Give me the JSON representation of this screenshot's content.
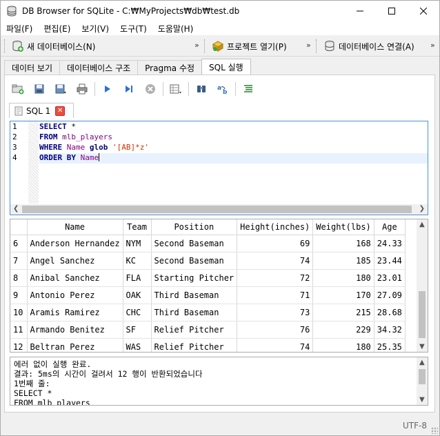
{
  "window": {
    "title": "DB Browser for SQLite - C:₩MyProjects₩db₩test.db"
  },
  "menu": [
    "파일(F)",
    "편집(E)",
    "보기(V)",
    "도구(T)",
    "도움말(H)"
  ],
  "toolbar": {
    "new_db": "새 데이터베이스(N)",
    "open_project": "프로젝트 열기(P)",
    "connect_db": "데이터베이스 연결(A)",
    "more": "»"
  },
  "tabs": [
    "데이터 보기",
    "데이터베이스 구조",
    "Pragma 수정",
    "SQL 실행"
  ],
  "sql_tab": {
    "label": "SQL 1",
    "close": "✕"
  },
  "editor": {
    "line_numbers": [
      "1",
      "2",
      "3",
      "4"
    ],
    "lines": [
      {
        "kw1": "SELECT",
        "rest": " *"
      },
      {
        "kw1": "FROM",
        "ident": " mlb_players"
      },
      {
        "kw1": "WHERE",
        "ident": " Name",
        "op": " glob ",
        "str": "'[AB]*z'"
      },
      {
        "kw1": "ORDER BY",
        "ident": " Name"
      }
    ]
  },
  "grid": {
    "columns": [
      "",
      "Name",
      "Team",
      "Position",
      "Height(inches)",
      "Weight(lbs)",
      "Age"
    ],
    "rows": [
      [
        "6",
        "Anderson Hernandez",
        "NYM",
        "Second Baseman",
        "69",
        "168",
        "24.33"
      ],
      [
        "7",
        "Angel Sanchez",
        "KC",
        "Second Baseman",
        "74",
        "185",
        "23.44"
      ],
      [
        "8",
        "Anibal Sanchez",
        "FLA",
        "Starting Pitcher",
        "72",
        "180",
        "23.01"
      ],
      [
        "9",
        "Antonio Perez",
        "OAK",
        "Third Baseman",
        "71",
        "170",
        "27.09"
      ],
      [
        "10",
        "Aramis Ramirez",
        "CHC",
        "Third Baseman",
        "73",
        "215",
        "28.68"
      ],
      [
        "11",
        "Armando Benitez",
        "SF",
        "Relief Pitcher",
        "76",
        "229",
        "34.32"
      ],
      [
        "12",
        "Beltran Perez",
        "WAS",
        "Relief Pitcher",
        "74",
        "180",
        "25.35"
      ]
    ]
  },
  "log": {
    "lines": [
      "에러 없이 실행 완료.",
      "결과: 5ms의 시간이 걸려서 12 행이 반환되었습니다",
      "1번째 줄:",
      "SELECT *",
      "FROM mlb_players"
    ]
  },
  "status": {
    "encoding": "UTF-8"
  },
  "colors": {
    "editor_border": "#4a90d9",
    "keyword": "#00007f",
    "identifier": "#7f007f",
    "string": "#cc3300",
    "close_tab": "#e8503a"
  },
  "icons": {
    "app": "db-cylinder-icon",
    "window_controls": [
      "minimize-icon",
      "maximize-icon",
      "close-icon"
    ]
  }
}
